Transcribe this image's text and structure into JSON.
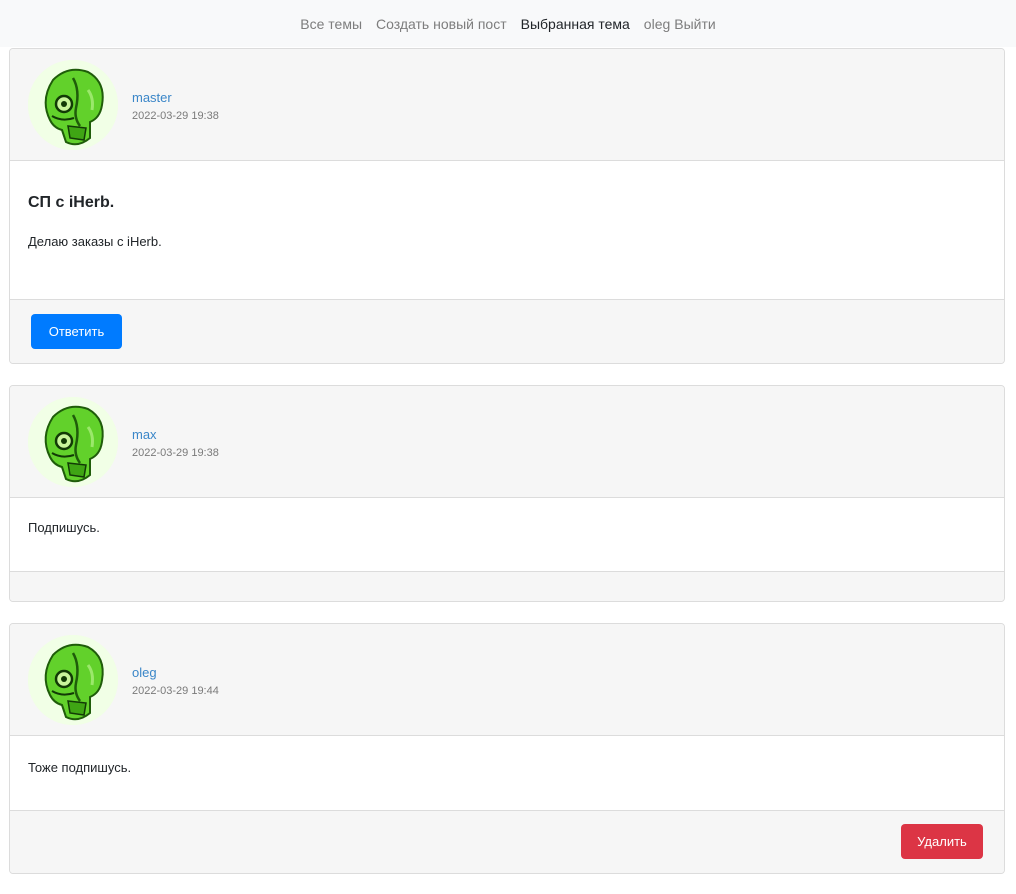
{
  "nav": {
    "items": [
      "Все темы",
      "Создать новый пост",
      "Выбранная тема"
    ],
    "user": "oleg",
    "logout": "Выйти"
  },
  "posts": [
    {
      "author": "master",
      "date": "2022-03-29 19:38",
      "title": "СП с iHerb.",
      "text": "Делаю заказы с iHerb.",
      "action": "Ответить"
    },
    {
      "author": "max",
      "date": "2022-03-29 19:38",
      "text": "Подпишусь."
    },
    {
      "author": "oleg",
      "date": "2022-03-29 19:44",
      "text": "Тоже подпишусь.",
      "action": "Удалить"
    }
  ],
  "colors": {
    "primary": "#007bff",
    "danger": "#dc3545",
    "link": "#3a86c8",
    "avatar_green": "#5fd12a"
  },
  "icons": {
    "avatar": "green-skull-xray-avatar"
  }
}
